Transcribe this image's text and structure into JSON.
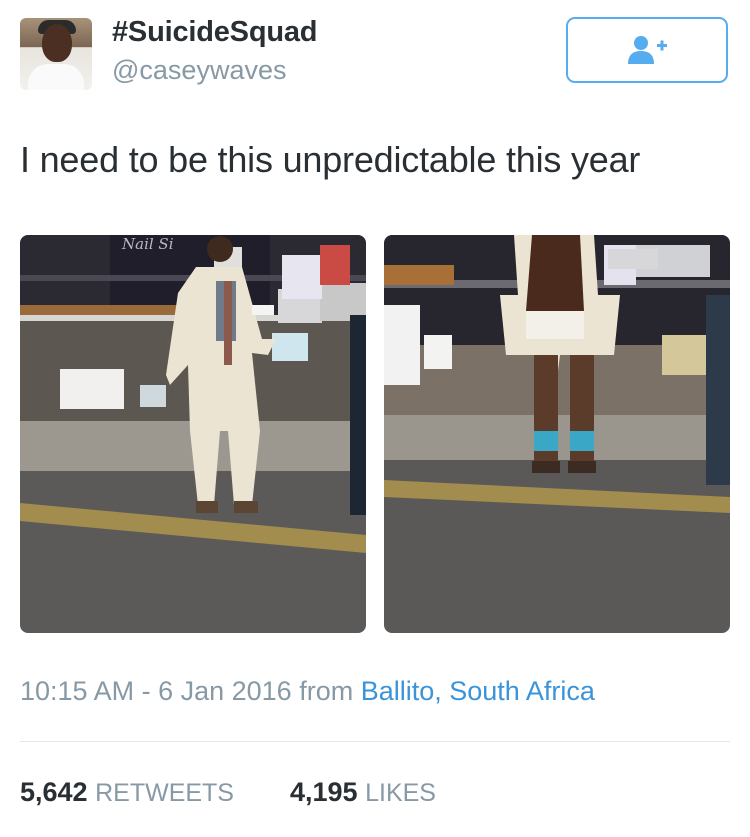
{
  "user": {
    "display_name": "#SuicideSquad",
    "handle": "@caseywaves"
  },
  "follow_icon": "add-user-icon",
  "accent_color": "#55acee",
  "tweet": {
    "text": "I need to be this unpredictable this year"
  },
  "photos": [
    {
      "icon": "photo-man-in-cream-suit-front",
      "sign_text": "Nail Si"
    },
    {
      "icon": "photo-man-in-cream-suit-back"
    }
  ],
  "meta": {
    "time_date": "10:15 AM - 6 Jan 2016",
    "from_label": "from",
    "location": "Ballito, South Africa"
  },
  "stats": {
    "retweets_count": "5,642",
    "retweets_label": "RETWEETS",
    "likes_count": "4,195",
    "likes_label": "LIKES"
  }
}
